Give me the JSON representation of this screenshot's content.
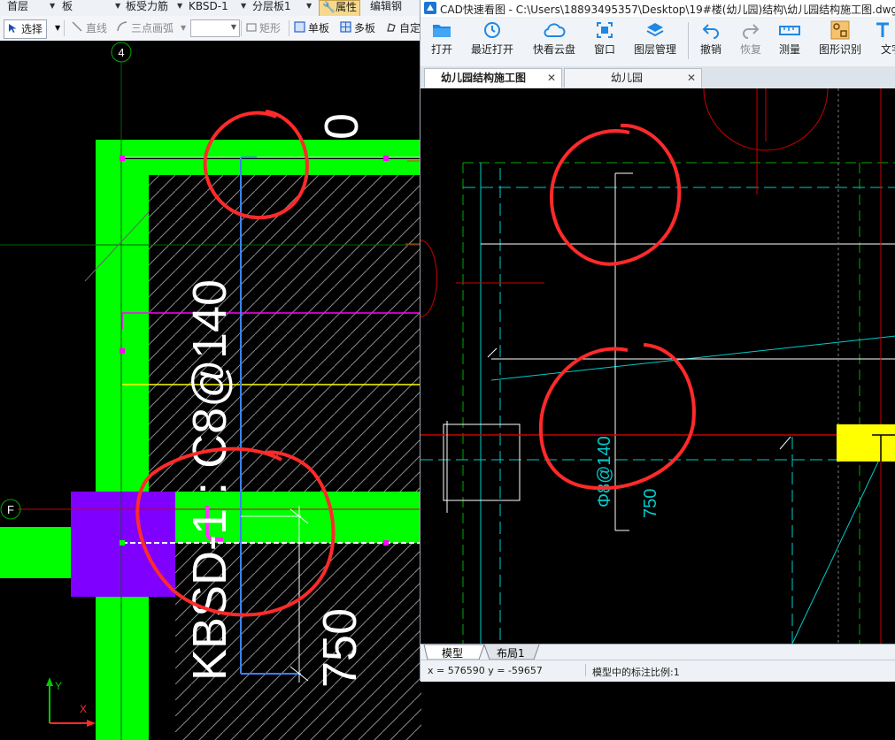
{
  "left_app": {
    "topbar": {
      "floor": "首层",
      "component": "板",
      "type": "板受力筋",
      "name": "KBSD-1",
      "layer": "分层板1",
      "props_label": "属性",
      "edit_label": "编辑钢"
    },
    "toolbar": {
      "select": "选择",
      "line": "直线",
      "arc": "三点画弧",
      "rect": "矩形",
      "single": "单板",
      "multi": "多板",
      "auto": "自定"
    },
    "drawing": {
      "axis_4": "4",
      "axis_F": "F",
      "rebar_label": "KBSD-1 : C8@140",
      "length_label": "750",
      "zero_label": "0",
      "ucs_y": "Y",
      "ucs_x": "X"
    }
  },
  "right_app": {
    "title": "CAD快速看图 - C:\\Users\\18893495357\\Desktop\\19#楼(幼儿园)结构\\幼儿园结构施工图.dwg",
    "tools": [
      {
        "label": "打开",
        "icon": "open-folder-icon"
      },
      {
        "label": "最近打开",
        "icon": "recent-icon"
      },
      {
        "label": "快看云盘",
        "icon": "cloud-icon"
      },
      {
        "label": "窗口",
        "icon": "window-icon"
      },
      {
        "label": "图层管理",
        "icon": "layers-icon"
      },
      {
        "label": "撤销",
        "icon": "undo-icon"
      },
      {
        "label": "恢复",
        "icon": "redo-icon"
      },
      {
        "label": "测量",
        "icon": "ruler-icon"
      },
      {
        "label": "图形识别",
        "icon": "shape-recognition-icon"
      },
      {
        "label": "文字",
        "icon": "text-icon"
      }
    ],
    "tabs": [
      {
        "label": "幼儿园结构施工图",
        "active": true
      },
      {
        "label": "幼儿园",
        "active": false
      }
    ],
    "drawing": {
      "rebar_label": "Φ8@140",
      "length_label": "750"
    },
    "layout_tabs": [
      "模型",
      "布局1"
    ],
    "status": {
      "coords": "x = 576590  y = -59657",
      "scale": "模型中的标注比例:1"
    }
  }
}
